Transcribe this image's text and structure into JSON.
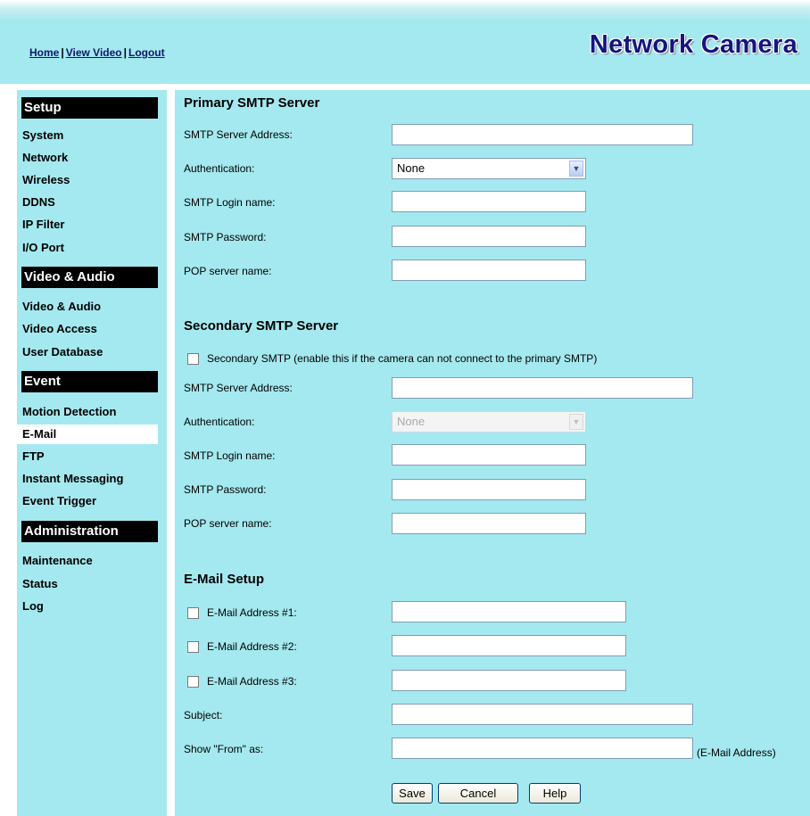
{
  "header": {
    "links": [
      "Home",
      "View Video",
      "Logout"
    ],
    "separator": "|",
    "brand": "Network Camera"
  },
  "sidebar": {
    "setup": {
      "heading": "Setup",
      "items": [
        "System",
        "Network",
        "Wireless",
        "DDNS",
        "IP Filter",
        "I/O Port"
      ]
    },
    "video_audio": {
      "heading": "Video & Audio",
      "items": [
        "Video & Audio",
        "Video Access",
        "User Database"
      ]
    },
    "event": {
      "heading": "Event",
      "items": [
        "Motion Detection",
        "E-Mail",
        "FTP",
        "Instant Messaging",
        "Event Trigger"
      ]
    },
    "administration": {
      "heading": "Administration",
      "items": [
        "Maintenance",
        "Status",
        "Log"
      ]
    },
    "active_item": "E-Mail"
  },
  "primary": {
    "title": "Primary SMTP Server",
    "server_label": "SMTP Server Address:",
    "server_value": "",
    "auth_label": "Authentication:",
    "auth_value": "None",
    "login_label": "SMTP Login name:",
    "login_value": "",
    "password_label": "SMTP Password:",
    "password_value": "",
    "pop_label": "POP server name:",
    "pop_value": ""
  },
  "secondary": {
    "title": "Secondary SMTP Server",
    "enable_label": "Secondary SMTP (enable this if the camera can not connect to the primary SMTP)",
    "enable_checked": false,
    "server_label": "SMTP Server Address:",
    "server_value": "",
    "auth_label": "Authentication:",
    "auth_value": "None",
    "login_label": "SMTP Login name:",
    "login_value": "",
    "password_label": "SMTP Password:",
    "password_value": "",
    "pop_label": "POP server name:",
    "pop_value": ""
  },
  "email": {
    "title": "E-Mail Setup",
    "address1_label": "E-Mail Address #1:",
    "address1_value": "",
    "address2_label": "E-Mail Address #2:",
    "address2_value": "",
    "address3_label": "E-Mail Address #3:",
    "address3_value": "",
    "subject_label": "Subject:",
    "subject_value": "",
    "from_label": "Show \"From\" as:",
    "from_value": "",
    "from_note": "(E-Mail Address)"
  },
  "buttons": {
    "save": "Save",
    "cancel": "Cancel",
    "help": "Help"
  },
  "colors": {
    "panel_bg": "#a4e9ef",
    "brand": "#15157f",
    "heading_bg": "#000000"
  },
  "icons": [
    "chevron-down-icon",
    "checkbox-icon"
  ]
}
